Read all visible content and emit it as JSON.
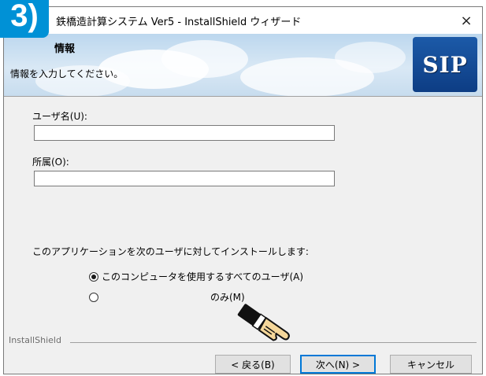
{
  "step_badge": "3)",
  "window": {
    "title": "鉄橋造計算システム Ver5 - InstallShield ウィザード",
    "close_label": "×"
  },
  "header": {
    "title": "情報",
    "subtitle": "情報を入力してください。",
    "logo_text": "SIP"
  },
  "form": {
    "username_label": "ユーザ名(U):",
    "username_value": "",
    "affiliation_label": "所属(O):",
    "affiliation_value": "",
    "install_question": "このアプリケーションを次のユーザに対してインストールします:",
    "options": [
      {
        "label": "このコンピュータを使用するすべてのユーザ(A)",
        "selected": true
      },
      {
        "label": "のみ(M)",
        "selected": false
      }
    ]
  },
  "footer": {
    "brand": "InstallShield",
    "back_label": "< 戻る(B)",
    "next_label": "次へ(N) >",
    "cancel_label": "キャンセル"
  },
  "colors": {
    "badge": "#0091d6",
    "default_button_border": "#0078d7",
    "logo_bg": "#1c5aa8"
  }
}
